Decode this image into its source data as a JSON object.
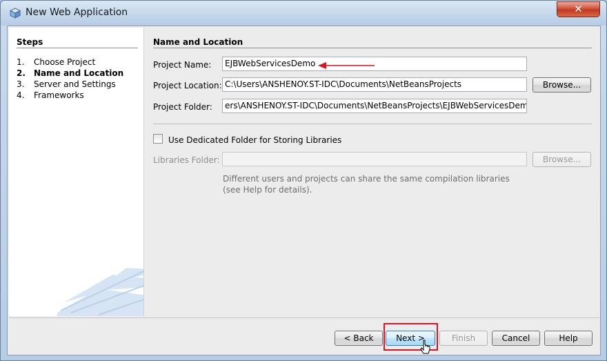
{
  "window": {
    "title": "New Web Application",
    "close_glyph": "✕"
  },
  "steps": {
    "title": "Steps",
    "items": [
      {
        "num": "1.",
        "label": "Choose Project",
        "current": false
      },
      {
        "num": "2.",
        "label": "Name and Location",
        "current": true
      },
      {
        "num": "3.",
        "label": "Server and Settings",
        "current": false
      },
      {
        "num": "4.",
        "label": "Frameworks",
        "current": false
      }
    ]
  },
  "main": {
    "section_title": "Name and Location",
    "project_name_label": "Project Name:",
    "project_name_value": "EJBWebServicesDemo",
    "project_location_label": "Project Location:",
    "project_location_value": "C:\\Users\\ANSHENOY.ST-IDC\\Documents\\NetBeansProjects",
    "project_folder_label": "Project Folder:",
    "project_folder_value": "ers\\ANSHENOY.ST-IDC\\Documents\\NetBeansProjects\\EJBWebServicesDemo",
    "browse_label": "Browse...",
    "dedicated_folder_label": "Use Dedicated Folder for Storing Libraries",
    "dedicated_folder_checked": false,
    "libraries_folder_label": "Libraries Folder:",
    "libraries_folder_value": "",
    "libraries_browse_label": "Browse...",
    "help_text": "Different users and projects can share the same compilation libraries (see Help for details)."
  },
  "buttons": {
    "back": "< Back",
    "next": "Next >",
    "finish": "Finish",
    "cancel": "Cancel",
    "help": "Help"
  },
  "colors": {
    "annotation_red": "#e0121f",
    "default_button_border": "#3c7fb1"
  }
}
